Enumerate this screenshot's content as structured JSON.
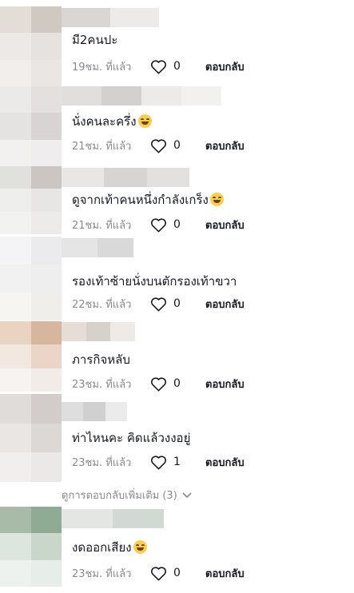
{
  "comments": [
    {
      "text": "มี2คนปะ",
      "emoji": false,
      "time": "19ชม. ที่แล้ว",
      "likes": "0",
      "reply": "ตอบกลับ"
    },
    {
      "text": "นั่งคนละครึ่ง",
      "emoji": true,
      "time": "21ชม. ที่แล้ว",
      "likes": "0",
      "reply": "ตอบกลับ"
    },
    {
      "text": "ดูจากเท้าคนหนึ่งกำลังเกร็ง",
      "emoji": true,
      "time": "21ชม. ที่แล้ว",
      "likes": "0",
      "reply": "ตอบกลับ"
    },
    {
      "text": "รองเท้าซ้ายนั่งบนตักรองเท้าขวา",
      "emoji": false,
      "time": "22ชม. ที่แล้ว",
      "likes": "0",
      "reply": "ตอบกลับ"
    },
    {
      "text": "ภารกิจหลับ",
      "emoji": false,
      "time": "23ชม. ที่แล้ว",
      "likes": "0",
      "reply": "ตอบกลับ"
    },
    {
      "text": "ท่าไหนคะ คิดแล้วงงอยู่",
      "emoji": false,
      "time": "23ชม. ที่แล้ว",
      "likes": "1",
      "reply": "ตอบกลับ"
    },
    {
      "text": "งดออกเสียง",
      "emoji": true,
      "time": "23ชม. ที่แล้ว",
      "likes": "0",
      "reply": "ตอบกลับ"
    }
  ],
  "view_more": "ดูการตอบกลับเพิ่มเติม (3)",
  "icons": {
    "like": "heart-outline-icon",
    "expand": "chevron-down-icon",
    "emoji": "grinning-face-emoji"
  }
}
